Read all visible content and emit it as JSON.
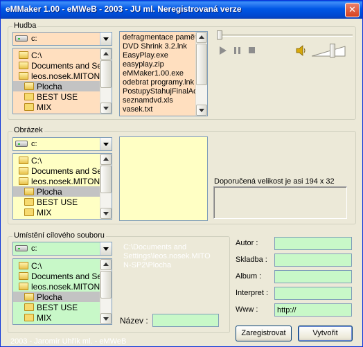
{
  "window": {
    "title": "eMMaker 1.00 - eMWeB - 2003 - JU ml.  Neregistrovaná verze",
    "close_glyph": "✕"
  },
  "hudba": {
    "legend": "Hudba",
    "drive": "c:",
    "dirs": [
      {
        "label": "C:\\",
        "selected": false
      },
      {
        "label": "Documents and Settin",
        "selected": false
      },
      {
        "label": "leos.nosek.MITON-S",
        "selected": false
      },
      {
        "label": "Plocha",
        "selected": true
      },
      {
        "label": "BEST USE",
        "selected": false
      },
      {
        "label": "MIX",
        "selected": false
      }
    ],
    "files": [
      "defragmentace pamět",
      "DVD Shrink 3.2.lnk",
      "EasyPlay.exe",
      "easyplay.zip",
      "eMMaker1.00.exe",
      "odebrat programy.lnk",
      "PostupyStahujFinalAd",
      "seznamdvd.xls",
      "vasek.txt"
    ]
  },
  "player": {
    "play_icon": "play-icon",
    "pause_icon": "pause-icon",
    "stop_icon": "stop-icon",
    "volume_icon": "speaker-icon"
  },
  "obrazek": {
    "legend": "Obrázek",
    "drive": "c:",
    "dirs": [
      {
        "label": "C:\\",
        "selected": false
      },
      {
        "label": "Documents and Setti",
        "selected": false
      },
      {
        "label": "leos.nosek.MITON-S",
        "selected": false
      },
      {
        "label": "Plocha",
        "selected": true
      },
      {
        "label": "BEST USE",
        "selected": false
      },
      {
        "label": "MIX",
        "selected": false
      }
    ],
    "recommended_size": "Doporučená velikost je asi 194 x 32"
  },
  "cil": {
    "legend": "Umístění cílového souboru",
    "drive": "c:",
    "dirs": [
      {
        "label": "C:\\",
        "selected": false
      },
      {
        "label": "Documents and Settin",
        "selected": false
      },
      {
        "label": "leos.nosek.MITON-S",
        "selected": false
      },
      {
        "label": "Plocha",
        "selected": true
      },
      {
        "label": "BEST USE",
        "selected": false
      },
      {
        "label": "MIX",
        "selected": false
      }
    ],
    "path_lines": [
      "C:\\Documents and",
      "Settings\\leos.nosek.MITO",
      "N-SP2\\Plocha"
    ],
    "name_label": "Název :",
    "name_value": ""
  },
  "meta": {
    "autor_label": "Autor :",
    "autor_value": "",
    "skladba_label": "Skladba :",
    "skladba_value": "",
    "album_label": "Album :",
    "album_value": "",
    "interpret_label": "Interpret :",
    "interpret_value": "",
    "www_label": "Www :",
    "www_value": "http://"
  },
  "buttons": {
    "register": "Zaregistrovat",
    "create": "Vytvořit"
  },
  "footer": "2003 - Jaromír Uhřík ml. - eMWeB",
  "colors": {
    "music_bg": "#ffdfbf",
    "image_bg": "#ffffc4",
    "target_bg": "#c8f8c8",
    "titlebar": "#0054e3"
  }
}
